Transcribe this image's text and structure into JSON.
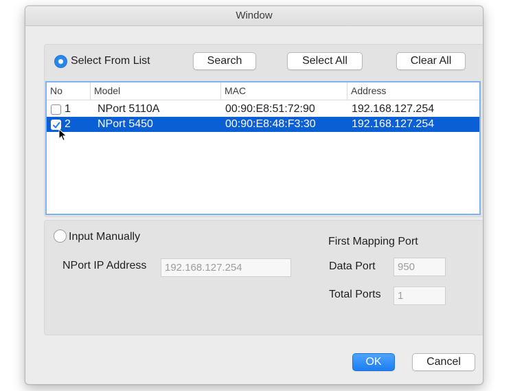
{
  "window": {
    "title": "Window"
  },
  "select_from_list": {
    "label": "Select From List",
    "selected": true,
    "buttons": {
      "search": "Search",
      "select_all": "Select All",
      "clear_all": "Clear All"
    }
  },
  "device_table": {
    "columns": [
      "No",
      "Model",
      "MAC",
      "Address"
    ],
    "rows": [
      {
        "no": "1",
        "model": "NPort 5110A",
        "mac": "00:90:E8:51:72:90",
        "address": "192.168.127.254",
        "checked": false,
        "selected": false
      },
      {
        "no": "2",
        "model": "NPort 5450",
        "mac": "00:90:E8:48:F3:30",
        "address": "192.168.127.254",
        "checked": true,
        "selected": true
      }
    ]
  },
  "input_manually": {
    "label": "Input Manually",
    "selected": false,
    "ip_label": "NPort IP Address",
    "ip_value": "192.168.127.254",
    "first_mapping_port": "First Mapping Port",
    "data_port_label": "Data Port",
    "data_port_value": "950",
    "total_ports_label": "Total Ports",
    "total_ports_value": "1"
  },
  "footer": {
    "ok": "OK",
    "cancel": "Cancel"
  },
  "colors": {
    "accent": "#2b86e8",
    "selection": "#0b5fd4",
    "table_border": "#7fb1ef"
  },
  "icons": [
    "arrow-cursor-icon",
    "checkmark-icon"
  ]
}
